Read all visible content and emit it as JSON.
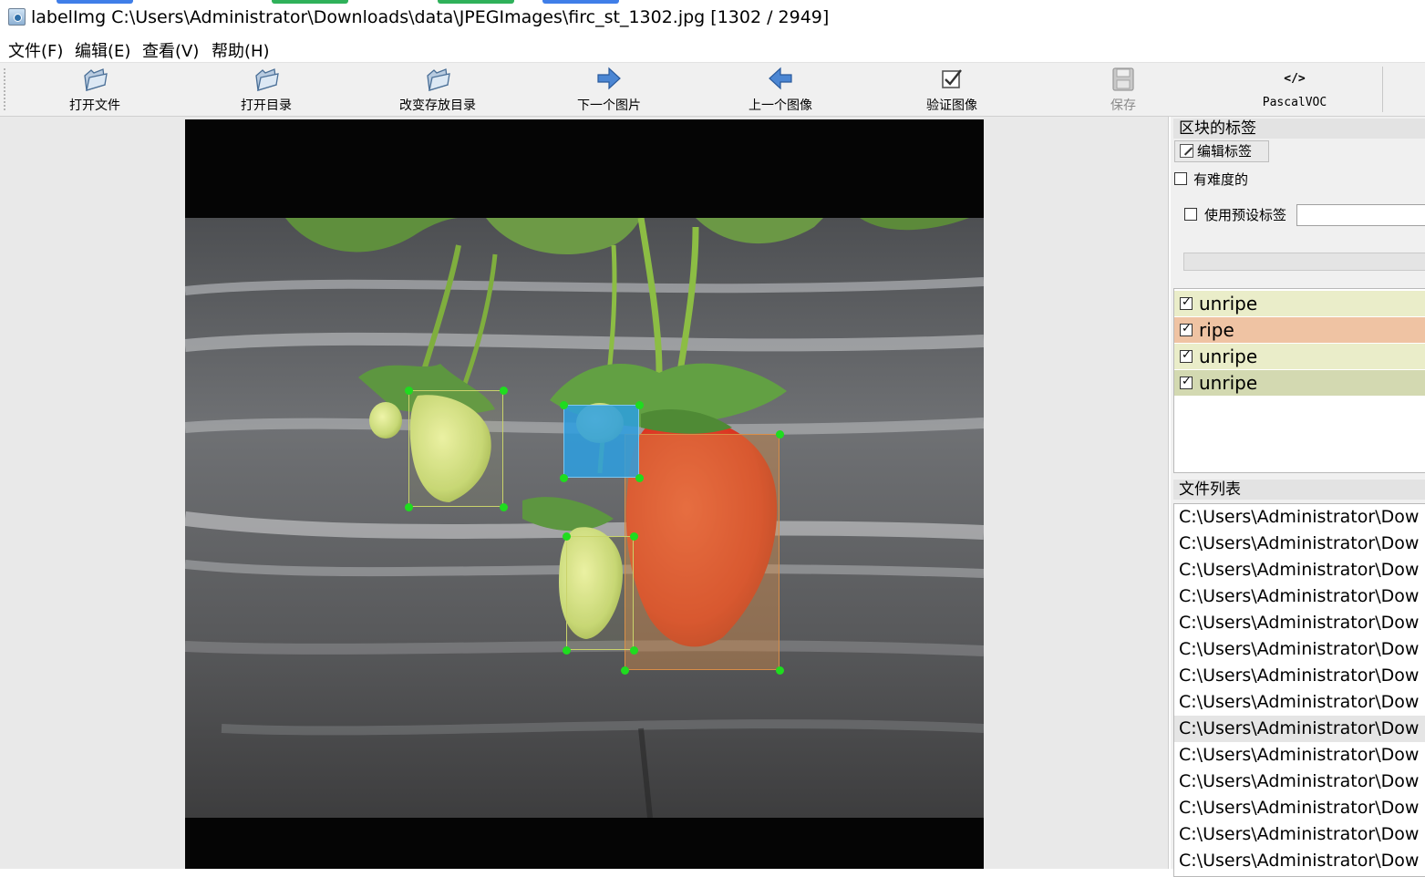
{
  "window": {
    "title": "labelImg C:\\Users\\Administrator\\Downloads\\data\\JPEGImages\\firc_st_1302.jpg [1302 / 2949]"
  },
  "menu": [
    "文件(F)",
    "编辑(E)",
    "查看(V)",
    "帮助(H)"
  ],
  "toolbar": {
    "open_file": "打开文件",
    "open_dir": "打开目录",
    "change_save_dir": "改变存放目录",
    "next_image": "下一个图片",
    "prev_image": "上一个图像",
    "verify_image": "验证图像",
    "save": "保存",
    "format": "PascalVOC",
    "format_icon_text": "</>"
  },
  "dock": {
    "box_labels_title": "区块的标签",
    "edit_label_button": "编辑标签",
    "difficult_label": "有难度的",
    "use_default_label": "使用预设标签",
    "default_label_value": "",
    "labels": [
      {
        "text": "unripe",
        "checked": true,
        "color": "#eaedc9"
      },
      {
        "text": "ripe",
        "checked": true,
        "color": "#efc3a3"
      },
      {
        "text": "unripe",
        "checked": true,
        "color": "#eaedc9"
      },
      {
        "text": "unripe",
        "checked": true,
        "color": "#d3d9b1"
      }
    ],
    "file_list_title": "文件列表",
    "files": [
      "C:\\Users\\Administrator\\Dow",
      "C:\\Users\\Administrator\\Dow",
      "C:\\Users\\Administrator\\Dow",
      "C:\\Users\\Administrator\\Dow",
      "C:\\Users\\Administrator\\Dow",
      "C:\\Users\\Administrator\\Dow",
      "C:\\Users\\Administrator\\Dow",
      "C:\\Users\\Administrator\\Dow",
      "C:\\Users\\Administrator\\Dow",
      "C:\\Users\\Administrator\\Dow",
      "C:\\Users\\Administrator\\Dow",
      "C:\\Users\\Administrator\\Dow",
      "C:\\Users\\Administrator\\Dow",
      "C:\\Users\\Administrator\\Dow"
    ],
    "selected_file_index": 8
  },
  "annotations": [
    {
      "label": "unripe",
      "color": "#c9d36b"
    },
    {
      "label": "ripe",
      "color": "#d98d47"
    },
    {
      "label": "unripe",
      "color": "#c9d36b"
    },
    {
      "label": "unripe",
      "color": "#2d9fe0"
    }
  ]
}
